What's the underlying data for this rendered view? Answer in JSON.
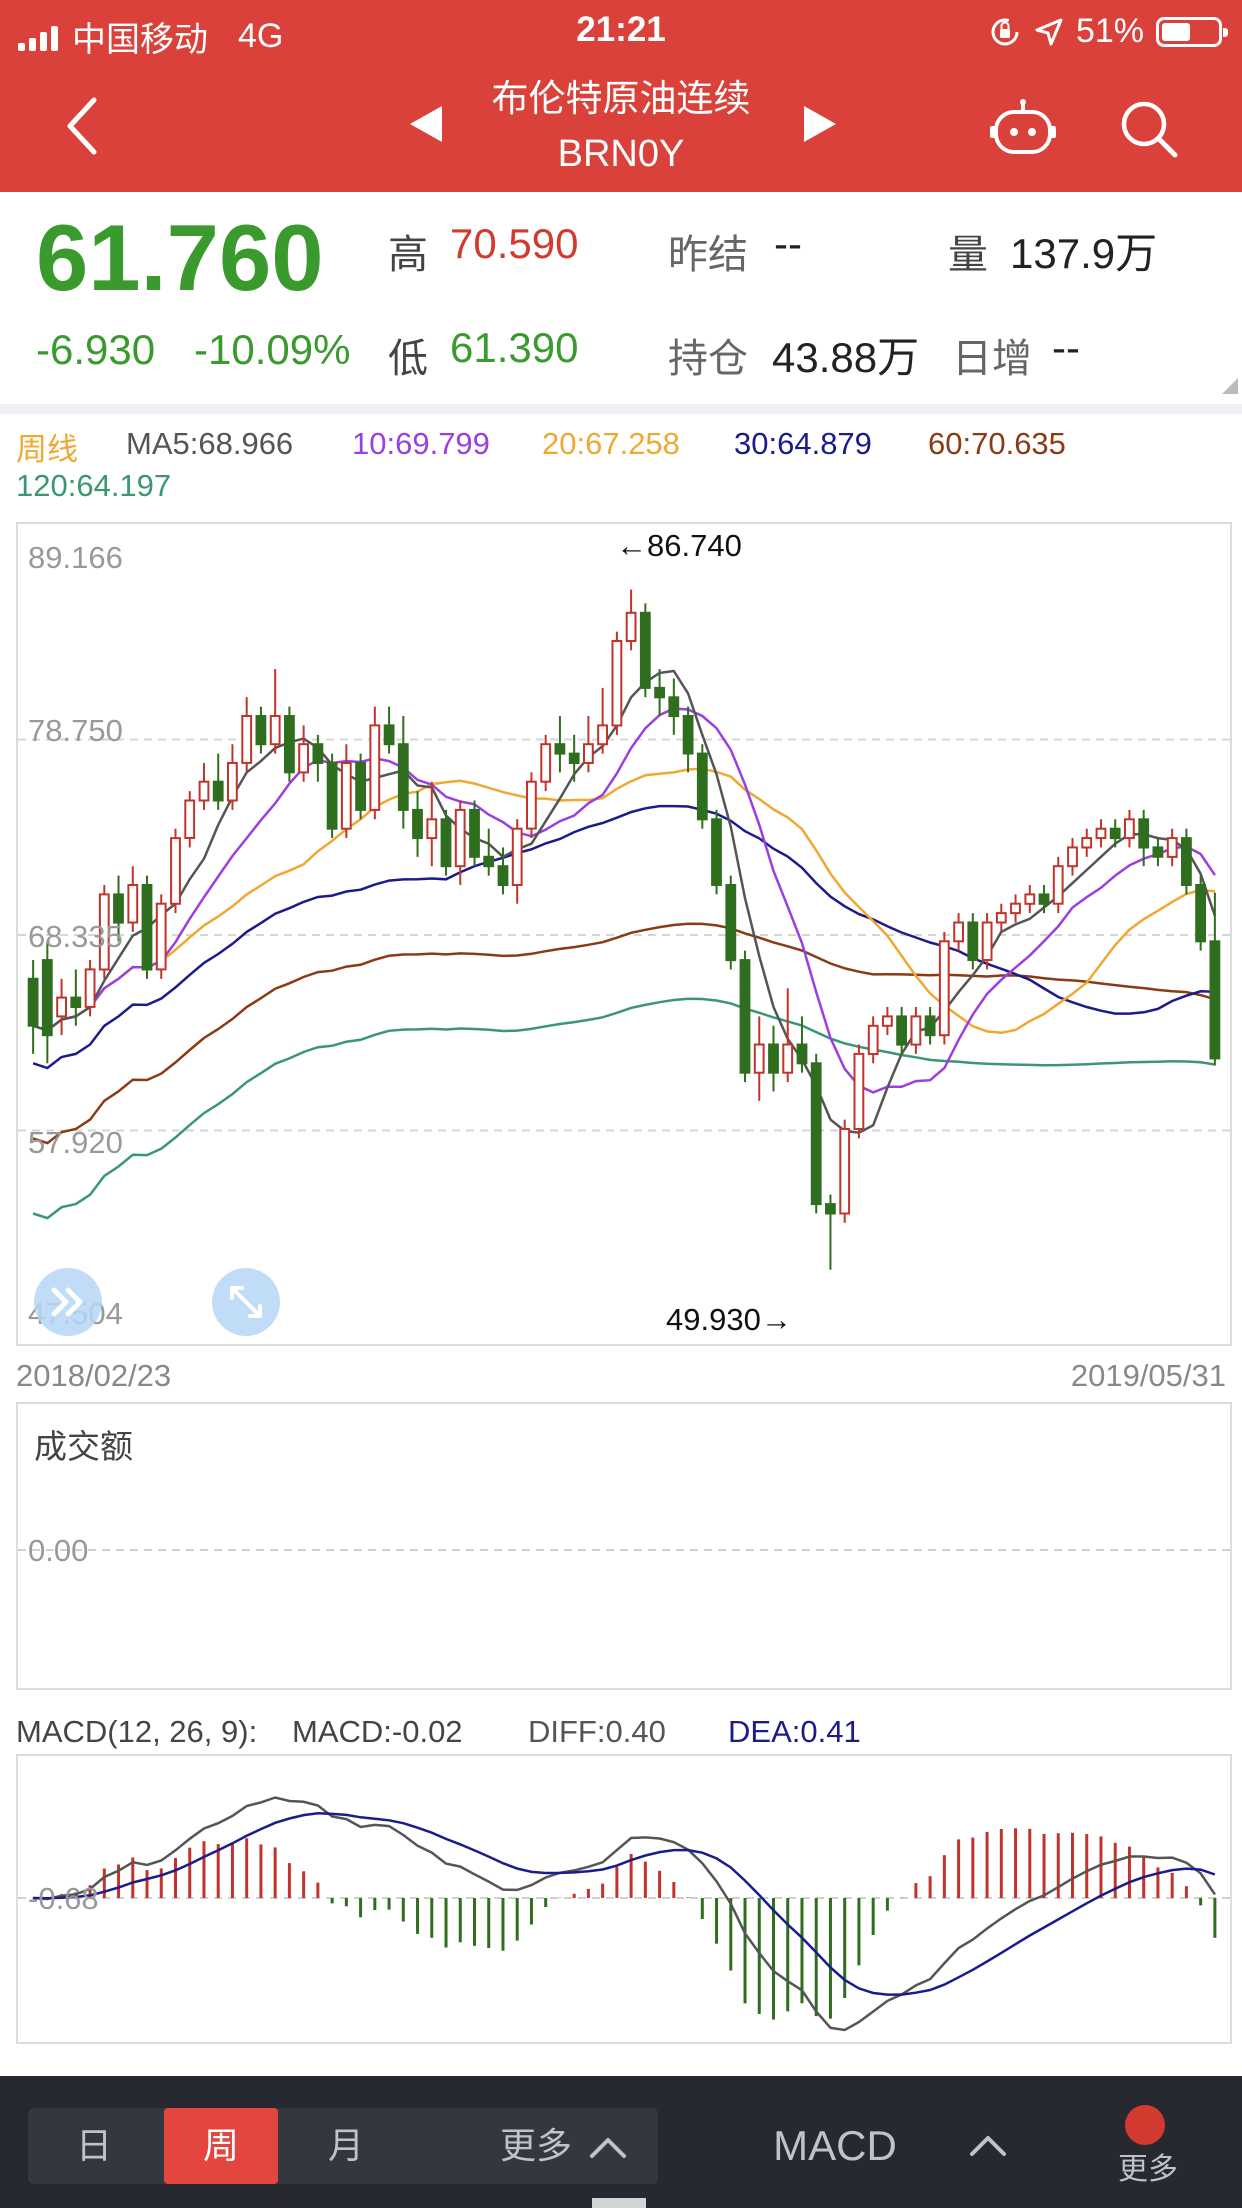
{
  "status_bar": {
    "carrier": "中国移动",
    "network": "4G",
    "time": "21:21",
    "battery_percent": "51%",
    "battery_level": 0.51,
    "icons": [
      "signal-icon",
      "orientation-lock-icon",
      "location-arrow-icon",
      "battery-icon"
    ]
  },
  "nav": {
    "title": "布伦特原油连续",
    "code": "BRN0Y",
    "icons": [
      "back-chevron-icon",
      "prev-triangle-icon",
      "next-triangle-icon",
      "robot-icon",
      "search-icon"
    ]
  },
  "quote": {
    "price": "61.760",
    "change": "-6.930",
    "change_pct": "-10.09%",
    "high_label": "高",
    "high": "70.590",
    "low_label": "低",
    "low": "61.390",
    "prev_settle_label": "昨结",
    "prev_settle": "--",
    "open_interest_label": "持仓",
    "open_interest": "43.88万",
    "volume_label": "量",
    "volume": "137.9万",
    "daily_inc_label": "日增",
    "daily_inc": "--"
  },
  "ma_legend": {
    "period": "周线",
    "ma5": "MA5:68.966",
    "ma10": "10:69.799",
    "ma20": "20:67.258",
    "ma30": "30:64.879",
    "ma60": "60:70.635",
    "ma120": "120:64.197"
  },
  "colors": {
    "nav_red": "#d9413a",
    "up": "#c1332b",
    "down": "#2f6e1e",
    "ma5": "#555555",
    "ma10": "#9b3fe0",
    "ma20": "#f0a830",
    "ma30": "#1b1b8c",
    "ma60": "#8b3a14",
    "ma120": "#3a9870"
  },
  "chart_labels": {
    "y_ticks": [
      "89.166",
      "78.750",
      "68.335",
      "57.920",
      "47.504"
    ],
    "high_marker": "←86.740",
    "low_marker": "49.930→",
    "start_date": "2018/02/23",
    "end_date": "2019/05/31",
    "volume_title": "成交额",
    "volume_zero": "0.00",
    "macd_title": "MACD(12, 26, 9):",
    "macd_value": "MACD:-0.02",
    "diff_value": "DIFF:0.40",
    "dea_value": "DEA:0.41",
    "macd_tick": "-0.68"
  },
  "chart_data": {
    "type": "candlestick",
    "ylim": [
      47.504,
      89.166
    ],
    "y_ticks": [
      89.166,
      78.75,
      68.335,
      57.92,
      47.504
    ],
    "x_range": [
      "2018/02/23",
      "2019/05/31"
    ],
    "grid": true,
    "candles": [
      [
        66.0,
        63.5,
        67.0,
        62.0
      ],
      [
        67.0,
        63.0,
        68.0,
        61.5
      ],
      [
        64.0,
        65.0,
        66.0,
        63.0
      ],
      [
        65.0,
        64.5,
        66.5,
        63.5
      ],
      [
        64.5,
        66.5,
        67.0,
        64.0
      ],
      [
        66.5,
        70.5,
        71.0,
        66.0
      ],
      [
        70.5,
        69.0,
        71.5,
        68.0
      ],
      [
        69.0,
        71.0,
        72.0,
        68.5
      ],
      [
        71.0,
        66.5,
        71.5,
        66.0
      ],
      [
        66.5,
        70.0,
        70.5,
        66.0
      ],
      [
        70.0,
        73.5,
        74.0,
        69.5
      ],
      [
        73.5,
        75.5,
        76.0,
        73.0
      ],
      [
        75.5,
        76.5,
        77.5,
        75.0
      ],
      [
        76.5,
        75.5,
        78.0,
        75.0
      ],
      [
        75.5,
        77.5,
        78.5,
        75.0
      ],
      [
        77.5,
        80.0,
        81.0,
        77.0
      ],
      [
        80.0,
        78.5,
        80.5,
        78.0
      ],
      [
        78.5,
        80.0,
        82.5,
        78.0
      ],
      [
        80.0,
        77.0,
        80.5,
        76.5
      ],
      [
        77.0,
        78.5,
        79.5,
        76.5
      ],
      [
        78.5,
        77.5,
        79.0,
        76.5
      ],
      [
        77.5,
        74.0,
        78.0,
        73.5
      ],
      [
        74.0,
        77.5,
        78.5,
        73.5
      ],
      [
        77.5,
        75.0,
        78.0,
        74.5
      ],
      [
        75.0,
        79.5,
        80.5,
        74.5
      ],
      [
        79.5,
        78.5,
        80.5,
        78.0
      ],
      [
        78.5,
        75.0,
        80.0,
        74.0
      ],
      [
        75.0,
        73.5,
        76.0,
        72.5
      ],
      [
        73.5,
        74.5,
        76.5,
        72.0
      ],
      [
        74.5,
        72.0,
        75.0,
        71.5
      ],
      [
        72.0,
        75.0,
        75.5,
        71.0
      ],
      [
        75.0,
        72.5,
        75.5,
        72.0
      ],
      [
        72.5,
        72.0,
        74.0,
        71.5
      ],
      [
        72.0,
        71.0,
        73.0,
        70.5
      ],
      [
        71.0,
        74.0,
        74.5,
        70.0
      ],
      [
        74.0,
        76.5,
        77.0,
        73.5
      ],
      [
        76.5,
        78.5,
        79.0,
        76.0
      ],
      [
        78.5,
        78.0,
        80.0,
        77.0
      ],
      [
        78.0,
        77.5,
        79.0,
        76.5
      ],
      [
        77.5,
        78.5,
        80.0,
        77.0
      ],
      [
        78.5,
        79.5,
        81.5,
        78.0
      ],
      [
        79.5,
        84.0,
        84.5,
        79.0
      ],
      [
        84.0,
        85.5,
        86.74,
        83.5
      ],
      [
        85.5,
        81.5,
        86.0,
        81.0
      ],
      [
        81.5,
        81.0,
        82.5,
        80.0
      ],
      [
        81.0,
        80.0,
        82.0,
        79.0
      ],
      [
        80.0,
        78.0,
        80.5,
        77.0
      ],
      [
        78.0,
        74.5,
        78.5,
        74.0
      ],
      [
        74.5,
        71.0,
        75.0,
        70.5
      ],
      [
        71.0,
        67.0,
        71.5,
        66.5
      ],
      [
        67.0,
        61.0,
        67.5,
        60.5
      ],
      [
        61.0,
        62.5,
        64.0,
        59.5
      ],
      [
        62.5,
        61.0,
        63.5,
        60.0
      ],
      [
        61.0,
        62.5,
        65.5,
        60.5
      ],
      [
        62.5,
        61.5,
        64.0,
        61.0
      ],
      [
        61.5,
        54.0,
        62.0,
        53.5
      ],
      [
        54.0,
        53.5,
        54.5,
        50.5
      ],
      [
        53.5,
        58.0,
        58.5,
        53.0
      ],
      [
        58.0,
        62.0,
        62.5,
        57.5
      ],
      [
        62.0,
        63.5,
        64.0,
        61.5
      ],
      [
        63.5,
        64.0,
        64.5,
        63.0
      ],
      [
        64.0,
        62.5,
        64.5,
        62.0
      ],
      [
        62.5,
        64.0,
        64.5,
        62.0
      ],
      [
        64.0,
        63.0,
        64.5,
        62.5
      ],
      [
        63.0,
        68.0,
        68.5,
        62.5
      ],
      [
        68.0,
        69.0,
        69.5,
        67.5
      ],
      [
        69.0,
        67.0,
        69.5,
        66.5
      ],
      [
        67.0,
        69.0,
        69.5,
        66.5
      ],
      [
        69.0,
        69.5,
        70.0,
        68.5
      ],
      [
        69.5,
        70.0,
        70.5,
        69.0
      ],
      [
        70.0,
        70.5,
        71.0,
        69.5
      ],
      [
        70.5,
        70.0,
        71.0,
        69.5
      ],
      [
        70.0,
        72.0,
        72.5,
        69.5
      ],
      [
        72.0,
        73.0,
        73.5,
        71.5
      ],
      [
        73.0,
        73.5,
        74.0,
        72.5
      ],
      [
        73.5,
        74.0,
        74.5,
        73.0
      ],
      [
        74.0,
        73.5,
        74.5,
        73.0
      ],
      [
        73.5,
        74.5,
        75.0,
        73.0
      ],
      [
        74.5,
        73.0,
        75.0,
        72.0
      ],
      [
        73.0,
        72.5,
        73.5,
        72.0
      ],
      [
        72.5,
        73.5,
        74.0,
        72.0
      ],
      [
        73.5,
        71.0,
        74.0,
        70.5
      ],
      [
        71.0,
        68.0,
        71.5,
        67.5
      ],
      [
        68.0,
        61.76,
        70.59,
        61.39
      ]
    ]
  }
}
